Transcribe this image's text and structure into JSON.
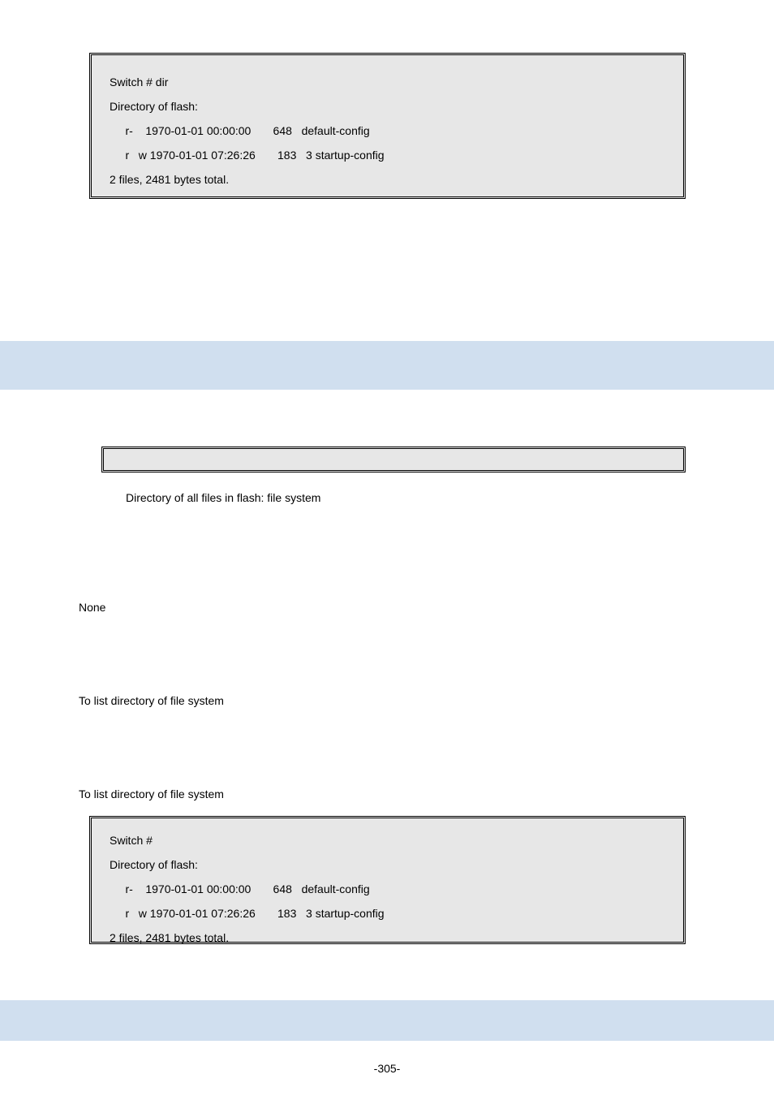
{
  "terminal1": {
    "line0": "Switch # dir",
    "line1": "Directory of flash:",
    "line2": "     r-    1970-01-01 00:00:00       648   default-config",
    "line3": "     r   w 1970-01-01 07:26:26       183   3 startup-config",
    "line4": "2 files, 2481 bytes total."
  },
  "description": "Directory of all files in flash: file system",
  "none_label": "None",
  "list1": "To list directory of file system",
  "list2": "To list directory of file system",
  "terminal2": {
    "line0": "Switch #",
    "line1": "Directory of flash:",
    "line2": "     r-    1970-01-01 00:00:00       648   default-config",
    "line3": "     r   w 1970-01-01 07:26:26       183   3 startup-config",
    "line4": "2 files, 2481 bytes total."
  },
  "page_number": "-305-"
}
